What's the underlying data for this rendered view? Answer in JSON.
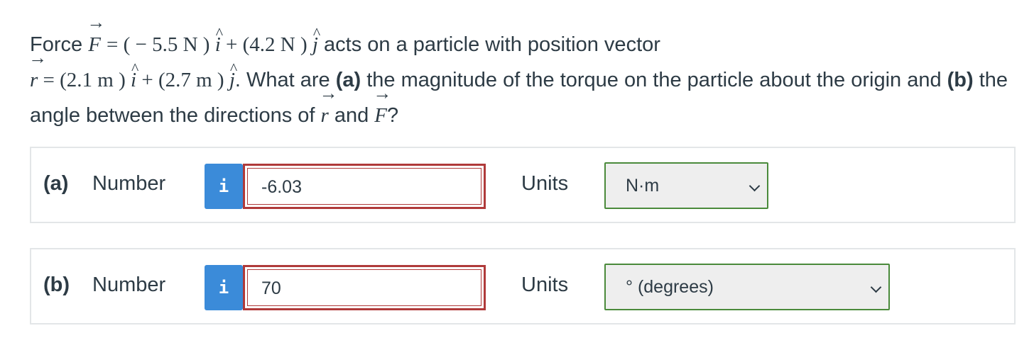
{
  "question": {
    "word_force": "Force",
    "F": "F",
    "r": "r",
    "force_expr": "= ( − 5.5 N ) ",
    "plus1": " + (4.2 N ) ",
    "acts": " acts on a particle with position vector",
    "pos_expr": " = (2.1 m ) ",
    "plus2": " + (2.7 m ) ",
    "what": ". What are ",
    "a_tag": "(a)",
    "a_text": " the magnitude of the torque on the particle about the origin and ",
    "b_tag": "(b)",
    "b_text": " the angle between the directions of ",
    "and": " and ",
    "qmark": "?",
    "i_hat": "i",
    "j_hat": "j"
  },
  "parts": [
    {
      "label": "(a)",
      "number_label": "Number",
      "info_icon": "i",
      "value": "-6.03",
      "units_label": "Units",
      "units_value": "N·m"
    },
    {
      "label": "(b)",
      "number_label": "Number",
      "info_icon": "i",
      "value": "70",
      "units_label": "Units",
      "units_value": "° (degrees)"
    }
  ],
  "colors": {
    "info": "#3b8bd9",
    "error_border": "#b03a3a",
    "select_border": "#4a8a3b"
  }
}
